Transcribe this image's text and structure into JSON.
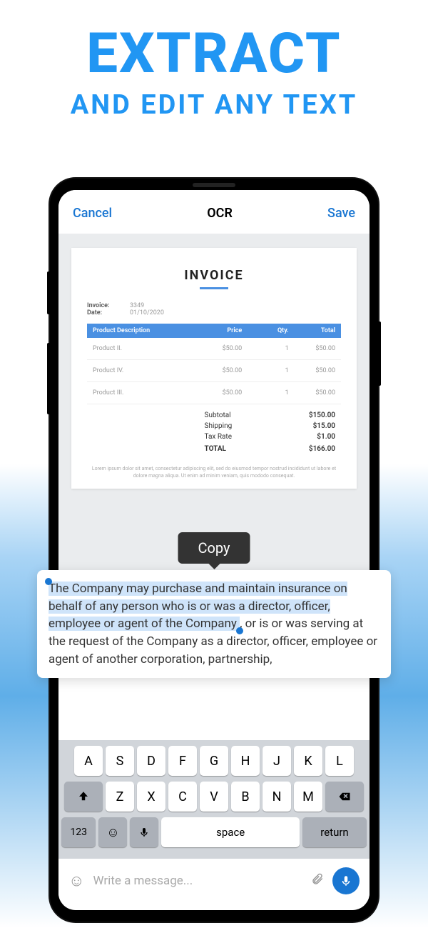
{
  "marketing": {
    "title": "EXTRACT",
    "subtitle": "AND EDIT ANY TEXT"
  },
  "header": {
    "cancel": "Cancel",
    "title": "OCR",
    "save": "Save"
  },
  "invoice": {
    "title": "INVOICE",
    "meta": {
      "invoice_label": "Invoice:",
      "invoice_val": "3349",
      "date_label": "Date:",
      "date_val": "01/10/2020"
    },
    "thead": {
      "desc": "Product Description",
      "price": "Price",
      "qty": "Qty.",
      "total": "Total"
    },
    "rows": [
      {
        "desc": "Product II.",
        "price": "$50.00",
        "qty": "1",
        "total": "$50.00"
      },
      {
        "desc": "Product IV.",
        "price": "$50.00",
        "qty": "1",
        "total": "$50.00"
      },
      {
        "desc": "Product III.",
        "price": "$50.00",
        "qty": "1",
        "total": "$50.00"
      }
    ],
    "totals": {
      "subtotal_label": "Subtotal",
      "subtotal": "$150.00",
      "shipping_label": "Shipping",
      "shipping": "$15.00",
      "tax_label": "Tax Rate",
      "tax": "$1.00",
      "total_label": "TOTAL",
      "total": "$166.00"
    },
    "lorem": "Lorem ipsum dolor sit amet, consectetur adipiscing elit, sed do eiusmod tempor nostrud incididunt ut labore et dolore magna aliqua. Ut enim ad minim veniam, quis mododo consequat."
  },
  "tooltip": {
    "copy": "Copy"
  },
  "ocr_text": {
    "selected": "The Company may purchase and maintain insurance on behalf of any person who is or was a director, officer, employee or agent of the Company",
    "rest": ", or is or was serving at the request of the Company as a director, officer, employee or agent of another corporation, partnership,"
  },
  "keyboard": {
    "row1": [
      "A",
      "S",
      "D",
      "F",
      "G",
      "H",
      "J",
      "K",
      "L"
    ],
    "row2": [
      "Z",
      "X",
      "C",
      "V",
      "B",
      "N",
      "M"
    ],
    "num": "123",
    "space": "space",
    "return": "return"
  },
  "message": {
    "placeholder": "Write a message..."
  }
}
